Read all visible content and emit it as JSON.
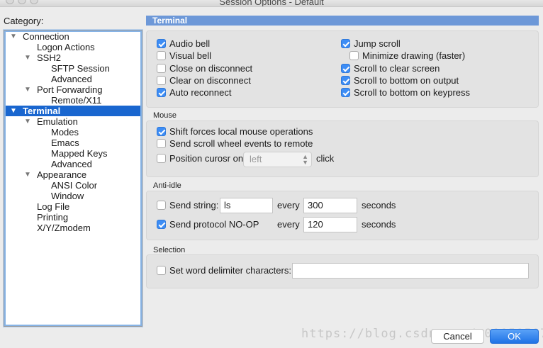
{
  "window": {
    "title": "Session Options - Default"
  },
  "category_label": "Category:",
  "tree": [
    {
      "label": "Connection",
      "expanded": true
    },
    {
      "label": "Logon Actions"
    },
    {
      "label": "SSH2",
      "expanded": true
    },
    {
      "label": "SFTP Session"
    },
    {
      "label": "Advanced"
    },
    {
      "label": "Port Forwarding",
      "expanded": true
    },
    {
      "label": "Remote/X11"
    },
    {
      "label": "Terminal",
      "expanded": true,
      "selected": true
    },
    {
      "label": "Emulation",
      "expanded": true
    },
    {
      "label": "Modes"
    },
    {
      "label": "Emacs"
    },
    {
      "label": "Mapped Keys"
    },
    {
      "label": "Advanced"
    },
    {
      "label": "Appearance",
      "expanded": true
    },
    {
      "label": "ANSI Color"
    },
    {
      "label": "Window"
    },
    {
      "label": "Log File"
    },
    {
      "label": "Printing"
    },
    {
      "label": "X/Y/Zmodem"
    }
  ],
  "panel_title": "Terminal",
  "terminal": {
    "audio_bell": {
      "label": "Audio bell",
      "checked": true
    },
    "visual_bell": {
      "label": "Visual bell",
      "checked": false
    },
    "close_on_disconnect": {
      "label": "Close on disconnect",
      "checked": false
    },
    "clear_on_disconnect": {
      "label": "Clear on disconnect",
      "checked": false
    },
    "auto_reconnect": {
      "label": "Auto reconnect",
      "checked": true
    },
    "jump_scroll": {
      "label": "Jump scroll",
      "checked": true
    },
    "minimize_drawing": {
      "label": "Minimize drawing (faster)",
      "checked": false
    },
    "scroll_to_clear": {
      "label": "Scroll to clear screen",
      "checked": true
    },
    "scroll_bottom_output": {
      "label": "Scroll to bottom on output",
      "checked": true
    },
    "scroll_bottom_keypress": {
      "label": "Scroll to bottom on keypress",
      "checked": true
    }
  },
  "mouse": {
    "title": "Mouse",
    "shift_forces": {
      "label": "Shift forces local mouse operations",
      "checked": true
    },
    "send_scroll": {
      "label": "Send scroll wheel events to remote",
      "checked": false
    },
    "position_cursor": {
      "label": "Position curosr on",
      "checked": false,
      "select_value": "left",
      "suffix": "click"
    }
  },
  "anti_idle": {
    "title": "Anti-idle",
    "send_string": {
      "label": "Send string:",
      "checked": false,
      "value": "ls",
      "every": "every",
      "interval": "300",
      "unit": "seconds"
    },
    "send_noop": {
      "label": "Send protocol NO-OP",
      "checked": true,
      "every": "every",
      "interval": "120",
      "unit": "seconds"
    }
  },
  "selection": {
    "title": "Selection",
    "word_delim": {
      "label": "Set word delimiter characters:",
      "checked": false,
      "value": ""
    }
  },
  "buttons": {
    "cancel": "Cancel",
    "ok": "OK"
  },
  "watermark": "https://blog.csdn.net/u0115959770",
  "colors": {
    "selection": "#1966cf",
    "header": "#6d98d8",
    "checkbox_on": "#3d8df5"
  }
}
